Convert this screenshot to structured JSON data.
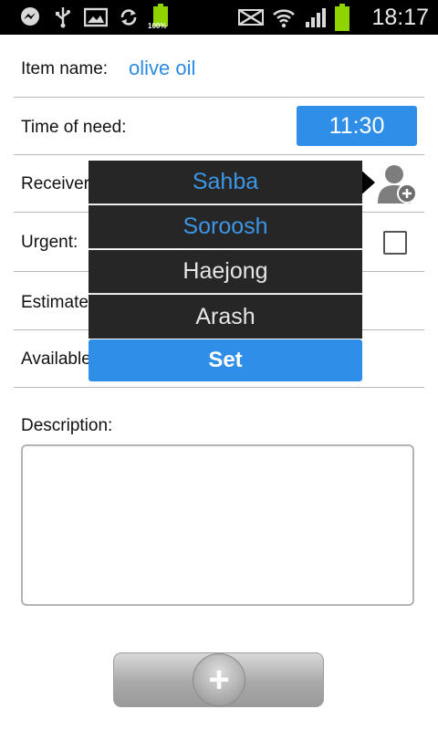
{
  "statusbar": {
    "time": "18:17",
    "battery_left_label": "100%",
    "icons_left": [
      "messenger-icon",
      "usb-icon",
      "gallery-icon",
      "sync-icon",
      "battery-full-icon"
    ],
    "icons_right": [
      "mute-icon",
      "wifi-icon",
      "signal-icon",
      "battery-icon"
    ]
  },
  "form": {
    "item_name_label": "Item name:",
    "item_name_value": "olive oil",
    "time_label": "Time of need:",
    "time_value": "11:30",
    "receiver_label": "Receiver:",
    "urgent_label": "Urgent:",
    "estimate_label": "Estimate:",
    "available_label": "Available:",
    "description_label": "Description:",
    "description_value": ""
  },
  "picker": {
    "items": [
      {
        "label": "Sahba",
        "selected": true
      },
      {
        "label": "Soroosh",
        "selected": true
      },
      {
        "label": "Haejong",
        "selected": false
      },
      {
        "label": "Arash",
        "selected": false
      }
    ],
    "set_label": "Set"
  },
  "add_button": {
    "label": "+"
  },
  "colors": {
    "accent": "#2e8ee8",
    "link": "#2a8be2",
    "picker_bg": "#262626"
  }
}
